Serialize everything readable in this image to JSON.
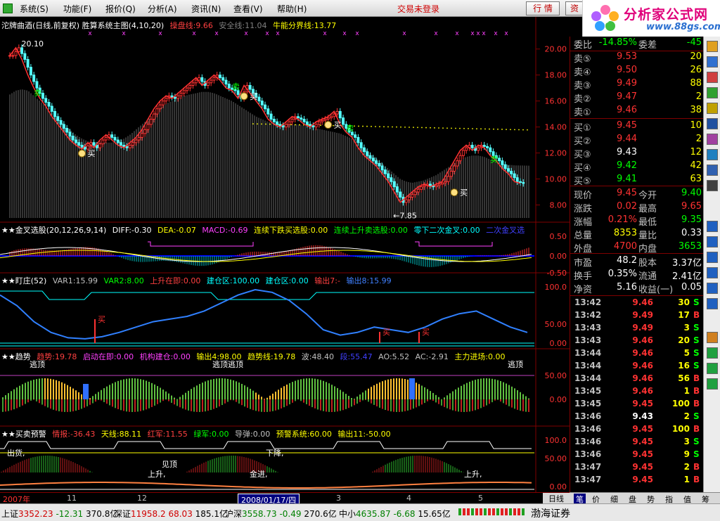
{
  "menu": {
    "items": [
      {
        "label": "系统(S)"
      },
      {
        "label": "功能(F)"
      },
      {
        "label": "报价(Q)"
      },
      {
        "label": "分析(A)"
      },
      {
        "label": "资讯(N)"
      },
      {
        "label": "查看(V)"
      },
      {
        "label": "帮助(H)"
      }
    ],
    "login_status": "交易未登录",
    "quote_button": "行 情",
    "info_button": "资"
  },
  "brand": {
    "name": "分析家公式网",
    "url": "www.88gs.com"
  },
  "main_panel": {
    "title": "沱牌曲酒(日线,前复权) 胜算系统主图(4,10,20)",
    "indicators": [
      {
        "text": "操盘线:9.66",
        "color": "#ff4040"
      },
      {
        "text": "安全线:11.04",
        "color": "#808080"
      },
      {
        "text": "牛能分界线:13.77",
        "color": "#ffff00"
      }
    ],
    "price_ticks": [
      "20.00",
      "18.00",
      "16.00",
      "14.00",
      "12.00",
      "10.00",
      "8.00"
    ],
    "high_label": "20.10",
    "low_label": "←7.85",
    "buy_label": "买",
    "sell_label": "卖"
  },
  "macd_panel": {
    "title": "★★金叉选股(20,12,26,9,14)",
    "indicators": [
      {
        "text": "DIFF:-0.30",
        "color": "#ffffff"
      },
      {
        "text": "DEA:-0.07",
        "color": "#ffff00"
      },
      {
        "text": "MACD:-0.69",
        "color": "#ff40ff"
      },
      {
        "text": "连续下跌买选股:0.00",
        "color": "#ffff00"
      },
      {
        "text": "连续上升卖选股:0.00",
        "color": "#00ff00"
      },
      {
        "text": "零下二次金叉:0.00",
        "color": "#00ffff"
      },
      {
        "text": "二次金叉选",
        "color": "#4040ff"
      }
    ],
    "ticks": [
      "0.50",
      "0.00",
      "-0.50"
    ]
  },
  "zhuang_panel": {
    "title": "★★盯庄(52)",
    "indicators": [
      {
        "text": "VAR1:15.99",
        "color": "#c0c0c0"
      },
      {
        "text": "VAR2:8.00",
        "color": "#00ff00"
      },
      {
        "text": "上升在即:0.00",
        "color": "#ff4040"
      },
      {
        "text": "建仓区:100.00",
        "color": "#00ffff"
      },
      {
        "text": "建仓区:0.00",
        "color": "#00ffff"
      },
      {
        "text": "输出7:-",
        "color": "#ff4040"
      },
      {
        "text": "输出8:15.99",
        "color": "#4080ff"
      }
    ],
    "ticks": [
      "100.0",
      "50.00",
      "0.00"
    ],
    "buy_label": "买"
  },
  "trend_panel": {
    "title": "★★趋势",
    "indicators": [
      {
        "text": "趋势:19.78",
        "color": "#ff4040"
      },
      {
        "text": "启动在即:0.00",
        "color": "#ff40ff"
      },
      {
        "text": "机构建仓:0.00",
        "color": "#ff40ff"
      },
      {
        "text": "输出4:98.00",
        "color": "#ffff00"
      },
      {
        "text": "趋势线:19.78",
        "color": "#ffff00"
      },
      {
        "text": "波:48.40",
        "color": "#c0c0c0"
      },
      {
        "text": "段:55.47",
        "color": "#4040ff"
      },
      {
        "text": "AO:5.52",
        "color": "#c0c0c0"
      },
      {
        "text": "AC:-2.91",
        "color": "#c0c0c0"
      },
      {
        "text": "主力进场:0.00",
        "color": "#ffff00"
      }
    ],
    "ticks": [
      "50.00",
      "0.00"
    ],
    "top_label": "逃顶"
  },
  "warning_panel": {
    "title": "★★买卖预警",
    "indicators": [
      {
        "text": "情报:-36.43",
        "color": "#ff4040"
      },
      {
        "text": "天线:88.11",
        "color": "#ffff00"
      },
      {
        "text": "红军:11.55",
        "color": "#ff4040"
      },
      {
        "text": "绿军:0.00",
        "color": "#00ff00"
      },
      {
        "text": "导弹:0.00",
        "color": "#c0c0c0"
      },
      {
        "text": "预警系统:60.00",
        "color": "#ffff00"
      },
      {
        "text": "输出11:-50.00",
        "color": "#ffff00"
      }
    ],
    "ticks": [
      "100.0",
      "50.00",
      "0.00"
    ],
    "labels": {
      "out": "出货,",
      "top": "见顶",
      "down": "下降,",
      "rise": "上升,",
      "gold": "金进,"
    }
  },
  "date_axis": {
    "labels": [
      "2007年",
      "11",
      "12",
      "3",
      "4",
      "5"
    ],
    "cursor_date": "2008/01/17/四",
    "period_tab": "日线"
  },
  "quote": {
    "weibi": {
      "label": "委比",
      "value": "-14.85%",
      "label2": "委差",
      "value2": "-45"
    },
    "asks": [
      {
        "label": "卖⑤",
        "price": "9.53",
        "vol": "20"
      },
      {
        "label": "卖④",
        "price": "9.50",
        "vol": "26"
      },
      {
        "label": "卖③",
        "price": "9.49",
        "vol": "88"
      },
      {
        "label": "卖②",
        "price": "9.47",
        "vol": "2"
      },
      {
        "label": "卖①",
        "price": "9.46",
        "vol": "38"
      }
    ],
    "bids": [
      {
        "label": "买①",
        "price": "9.45",
        "vol": "10"
      },
      {
        "label": "买②",
        "price": "9.44",
        "vol": "2"
      },
      {
        "label": "买③",
        "price": "9.43",
        "vol": "12"
      },
      {
        "label": "买④",
        "price": "9.42",
        "vol": "42"
      },
      {
        "label": "买⑤",
        "price": "9.41",
        "vol": "63"
      }
    ],
    "stats": [
      {
        "l1": "现价",
        "v1": "9.45",
        "c1": "#ff3232",
        "l2": "今开",
        "v2": "9.40",
        "c2": "#00ff00"
      },
      {
        "l1": "涨跌",
        "v1": "0.02",
        "c1": "#ff3232",
        "l2": "最高",
        "v2": "9.65",
        "c2": "#ff3232"
      },
      {
        "l1": "涨幅",
        "v1": "0.21%",
        "c1": "#ff3232",
        "l2": "最低",
        "v2": "9.35",
        "c2": "#00ff00"
      },
      {
        "l1": "总量",
        "v1": "8353",
        "c1": "#ffff00",
        "l2": "量比",
        "v2": "0.33",
        "c2": "#ffffff"
      },
      {
        "l1": "外盘",
        "v1": "4700",
        "c1": "#ff3232",
        "l2": "内盘",
        "v2": "3653",
        "c2": "#00ff00"
      }
    ],
    "fundamentals": [
      {
        "l1": "市盈",
        "v1": "48.2",
        "l2": "股本",
        "v2": "3.37亿"
      },
      {
        "l1": "换手",
        "v1": "0.35%",
        "l2": "流通",
        "v2": "2.41亿"
      },
      {
        "l1": "净资",
        "v1": "5.16",
        "l2": "收益(一)",
        "v2": "0.05"
      }
    ],
    "ticks": [
      {
        "time": "13:42",
        "price": "9.46",
        "vol": "30",
        "bs": "S",
        "bsColor": "#00ff00"
      },
      {
        "time": "13:42",
        "price": "9.49",
        "vol": "17",
        "bs": "B",
        "bsColor": "#ff3232"
      },
      {
        "time": "13:43",
        "price": "9.49",
        "vol": "3",
        "bs": "S",
        "bsColor": "#00ff00"
      },
      {
        "time": "13:43",
        "price": "9.46",
        "vol": "20",
        "bs": "S",
        "bsColor": "#00ff00"
      },
      {
        "time": "13:44",
        "price": "9.46",
        "vol": "5",
        "bs": "S",
        "bsColor": "#00ff00"
      },
      {
        "time": "13:44",
        "price": "9.46",
        "vol": "16",
        "bs": "S",
        "bsColor": "#00ff00"
      },
      {
        "time": "13:44",
        "price": "9.46",
        "vol": "56",
        "bs": "B",
        "bsColor": "#ff3232"
      },
      {
        "time": "13:45",
        "price": "9.46",
        "vol": "1",
        "bs": "B",
        "bsColor": "#ff3232"
      },
      {
        "time": "13:45",
        "price": "9.45",
        "vol": "100",
        "bs": "B",
        "bsColor": "#ff3232"
      },
      {
        "time": "13:46",
        "price": "9.43",
        "vol": "2",
        "bs": "S",
        "bsColor": "#00ff00"
      },
      {
        "time": "13:46",
        "price": "9.45",
        "vol": "100",
        "bs": "B",
        "bsColor": "#ff3232"
      },
      {
        "time": "13:46",
        "price": "9.45",
        "vol": "3",
        "bs": "S",
        "bsColor": "#00ff00"
      },
      {
        "time": "13:46",
        "price": "9.45",
        "vol": "9",
        "bs": "S",
        "bsColor": "#00ff00"
      },
      {
        "time": "13:47",
        "price": "9.45",
        "vol": "2",
        "bs": "B",
        "bsColor": "#ff3232"
      },
      {
        "time": "13:47",
        "price": "9.45",
        "vol": "1",
        "bs": "B",
        "bsColor": "#ff3232"
      }
    ]
  },
  "bottom_tabs": [
    "笔",
    "价",
    "细",
    "盘",
    "势",
    "指",
    "值",
    "筹"
  ],
  "status": {
    "indices": [
      {
        "name": "上证",
        "value": "3352.23",
        "change": "-12.31",
        "amount": "370.8亿"
      },
      {
        "name": "深证",
        "value": "11958.2",
        "change": "68.03",
        "amount": "185.1亿"
      },
      {
        "name": "沪深",
        "value": "3558.73",
        "change": "-0.49",
        "amount": "270.6亿"
      },
      {
        "name": "中小",
        "value": "4635.87",
        "change": "-6.68",
        "amount": "15.65亿"
      }
    ],
    "broker": "渤海证券"
  },
  "chart_data": {
    "type": "candlestick",
    "title": "沱牌曲酒(日线,前复权)",
    "ylim": [
      7,
      21.5
    ],
    "y_ticks": [
      8,
      10,
      12,
      14,
      16,
      18,
      20
    ],
    "high": 20.1,
    "low": 7.85,
    "close_path": [
      19.5,
      20.1,
      19.2,
      18.0,
      17.0,
      16.2,
      15.6,
      14.8,
      14.2,
      13.6,
      13.0,
      12.6,
      12.3,
      12.8,
      12.4,
      13.0,
      13.4,
      13.0,
      12.6,
      12.4,
      12.8,
      13.2,
      13.8,
      14.6,
      15.4,
      16.0,
      16.4,
      16.2,
      16.6,
      17.0,
      17.4,
      17.8,
      17.2,
      17.6,
      18.0,
      17.6,
      17.0,
      16.8,
      16.2,
      17.2,
      16.6,
      16.0,
      15.4,
      14.6,
      14.2,
      14.0,
      14.4,
      14.8,
      14.6,
      14.2,
      14.0,
      14.4,
      14.6,
      14.8,
      15.2,
      14.2,
      13.6,
      13.2,
      12.4,
      11.8,
      11.4,
      11.0,
      10.4,
      9.8,
      9.0,
      8.2,
      8.6,
      9.0,
      9.4,
      9.6,
      9.4,
      9.6,
      9.8,
      10.6,
      11.4,
      12.2,
      12.6,
      12.2,
      12.6,
      12.4,
      11.8,
      11.4,
      10.8,
      10.4,
      9.8,
      9.66
    ],
    "safety_line": [
      16.5,
      16.8,
      16.9,
      16.8,
      16.4,
      16.0,
      15.6,
      15.0,
      14.6,
      14.2,
      13.8,
      13.4,
      13.1,
      12.9,
      12.8,
      12.8,
      12.8,
      12.8,
      12.9,
      13.1,
      13.4,
      13.8,
      14.2,
      14.6,
      15.0,
      15.4,
      15.8,
      16.0,
      16.2,
      16.4,
      16.5,
      16.6,
      16.7,
      16.7,
      16.6,
      16.4,
      16.2,
      16.0,
      15.7,
      15.4,
      15.1,
      14.8,
      14.6,
      14.4,
      14.3,
      14.2,
      14.2,
      14.2,
      14.2,
      14.1,
      14.0,
      13.9,
      13.8,
      13.7,
      13.6,
      13.5,
      13.3,
      13.1,
      12.8,
      12.4,
      12.0,
      11.6,
      11.2,
      10.8,
      10.4,
      10.0,
      9.8,
      9.7,
      9.8,
      9.9,
      10.1,
      10.3,
      10.6,
      10.9,
      11.2,
      11.5,
      11.7,
      11.8,
      11.8,
      11.7,
      11.5,
      11.3,
      11.2,
      11.1,
      11.05,
      11.04
    ],
    "bull_line": 13.77
  }
}
